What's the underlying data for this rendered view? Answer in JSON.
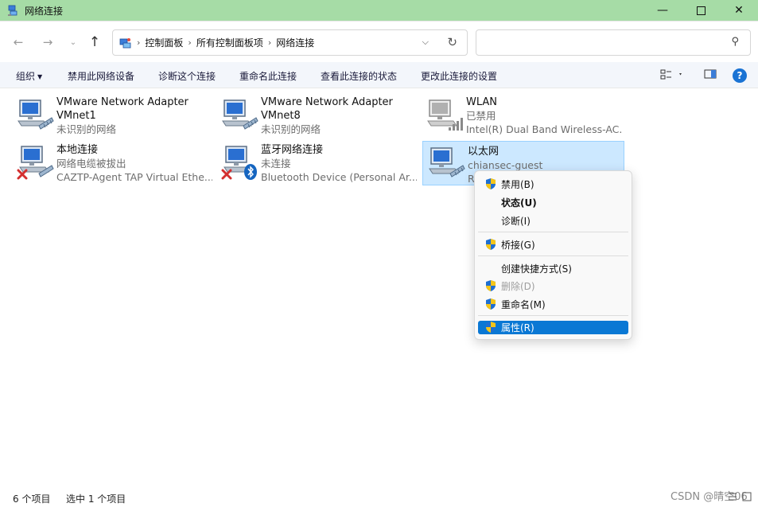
{
  "window": {
    "title": "网络连接",
    "minimize_icon": "minimize-icon",
    "maximize_icon": "maximize-icon",
    "close_icon": "close-icon"
  },
  "nav": {
    "back_icon": "back-arrow-icon",
    "forward_icon": "forward-arrow-icon",
    "recent_icon": "chevron-down-icon",
    "up_icon": "up-arrow-icon"
  },
  "address": {
    "breadcrumbs": [
      "控制面板",
      "所有控制面板项",
      "网络连接"
    ],
    "search_placeholder": ""
  },
  "toolbar": {
    "organize": "组织",
    "disable_device": "禁用此网络设备",
    "diagnose": "诊断这个连接",
    "rename": "重命名此连接",
    "view_status": "查看此连接的状态",
    "change_settings": "更改此连接的设置",
    "help": "?"
  },
  "connections": [
    {
      "name": "VMware Network Adapter VMnet1",
      "name_line1": "VMware Network Adapter",
      "name_line2": "VMnet1",
      "status": "未识别的网络",
      "device": "",
      "state": "normal",
      "icon": "ethernet-adapter-icon"
    },
    {
      "name": "VMware Network Adapter VMnet8",
      "name_line1": "VMware Network Adapter",
      "name_line2": "VMnet8",
      "status": "未识别的网络",
      "device": "",
      "state": "normal",
      "icon": "ethernet-adapter-icon"
    },
    {
      "name": "WLAN",
      "status": "已禁用",
      "device": "Intel(R) Dual Band Wireless-AC...",
      "state": "disabled",
      "icon": "wifi-adapter-icon"
    },
    {
      "name": "本地连接",
      "status": "网络电缆被拔出",
      "device": "CAZTP-Agent TAP Virtual Ethe...",
      "state": "error",
      "icon": "ethernet-adapter-icon"
    },
    {
      "name": "蓝牙网络连接",
      "status": "未连接",
      "device": "Bluetooth Device (Personal Ar...",
      "state": "error",
      "icon": "bluetooth-adapter-icon"
    },
    {
      "name": "以太网",
      "status": "chiansec-guest",
      "device": "R",
      "state": "selected",
      "icon": "ethernet-adapter-icon"
    }
  ],
  "context_menu": {
    "items": [
      {
        "label": "禁用(B)",
        "shield": true,
        "bold": false,
        "disabled": false
      },
      {
        "label": "状态(U)",
        "shield": false,
        "bold": true,
        "disabled": false
      },
      {
        "label": "诊断(I)",
        "shield": false,
        "bold": false,
        "disabled": false
      },
      {
        "label": "桥接(G)",
        "shield": true,
        "bold": false,
        "disabled": false
      },
      {
        "label": "创建快捷方式(S)",
        "shield": false,
        "bold": false,
        "disabled": false
      },
      {
        "label": "删除(D)",
        "shield": true,
        "bold": false,
        "disabled": true
      },
      {
        "label": "重命名(M)",
        "shield": true,
        "bold": false,
        "disabled": false
      },
      {
        "label": "属性(R)",
        "shield": true,
        "bold": false,
        "disabled": false,
        "highlighted": true
      }
    ]
  },
  "statusbar": {
    "item_count": "6 个项目",
    "selected_count": "选中 1 个项目"
  },
  "watermark": "CSDN @晴空06",
  "colors": {
    "titlebar": "#a6dca6",
    "selection": "#cce8ff",
    "menu_highlight": "#0a78d4",
    "error_red": "#d32f2f",
    "bluetooth_blue": "#1565c0"
  }
}
